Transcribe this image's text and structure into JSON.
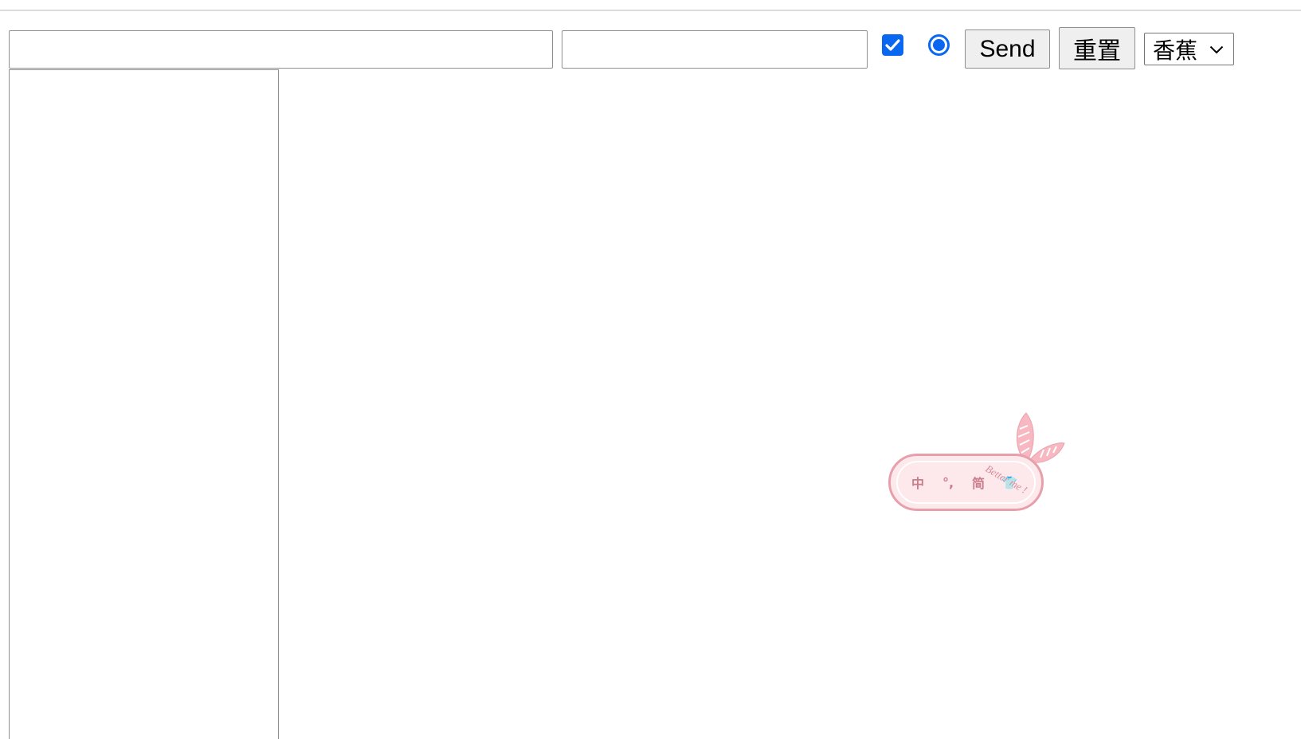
{
  "form": {
    "text_input_1_value": "",
    "text_input_2_value": "",
    "checkbox_checked": true,
    "radio_checked": true,
    "send_label": "Send",
    "reset_label": "重置",
    "select_value": "香蕉",
    "textarea_value": ""
  },
  "ime": {
    "items": [
      "中",
      "°,",
      "简",
      "👕"
    ],
    "tagline": "Better me !"
  },
  "colors": {
    "accent": "#0a67f0",
    "ime_pink": "#e7a0ab"
  }
}
